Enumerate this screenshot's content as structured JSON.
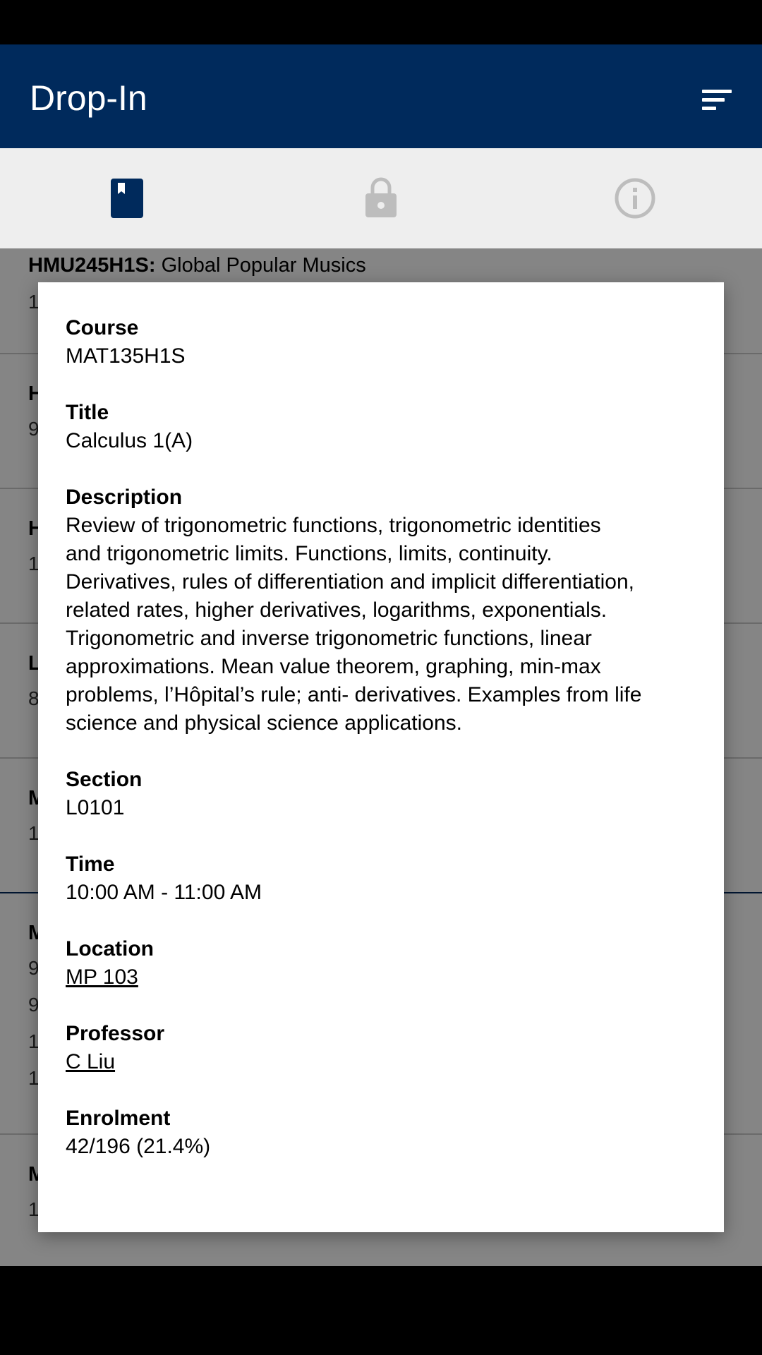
{
  "app": {
    "title": "Drop-In"
  },
  "tabs": [
    {
      "icon": "book-icon",
      "active": true
    },
    {
      "icon": "lock-icon",
      "active": false
    },
    {
      "icon": "info-icon",
      "active": false
    }
  ],
  "list": {
    "first_item": {
      "code": "HMU245H1S:",
      "name": "Global Popular Musics",
      "sub": "1"
    },
    "partial_items": [
      {
        "initial": "H",
        "sub": "9"
      },
      {
        "initial": "H",
        "sub": "1"
      },
      {
        "initial": "L",
        "sub": "8"
      },
      {
        "initial": "M",
        "sub": "1"
      },
      {
        "initial": "M",
        "subs": [
          "9",
          "9",
          "1",
          "1"
        ]
      },
      {
        "initial": "M",
        "sub": "1"
      }
    ]
  },
  "dialog": {
    "course_label": "Course",
    "course_value": "MAT135H1S",
    "title_label": "Title",
    "title_value": "Calculus 1(A)",
    "description_label": "Description",
    "description_lines": [
      "Review of trigonometric functions, trigonometric identities",
      "and trigonometric limits. Functions, limits, continuity.",
      "Derivatives, rules of differentiation and implicit differentiation,",
      "related rates, higher derivatives, logarithms, exponentials.",
      "Trigonometric and inverse trigonometric functions, linear",
      "approximations. Mean value theorem, graphing, min-max",
      "problems, l’Hôpital’s rule; anti- derivatives.  Examples from life",
      "science and physical science applications."
    ],
    "section_label": "Section",
    "section_value": "L0101",
    "time_label": "Time",
    "time_value": "10:00 AM - 11:00 AM",
    "location_label": "Location",
    "location_value": "MP 103",
    "professor_label": "Professor",
    "professor_value": "C Liu",
    "enrolment_label": "Enrolment",
    "enrolment_value": "42/196 (21.4%)"
  },
  "colors": {
    "primary": "#002A5C",
    "tab_inactive": "#BDBDBD",
    "tab_bar_bg": "#EEEEEE"
  }
}
